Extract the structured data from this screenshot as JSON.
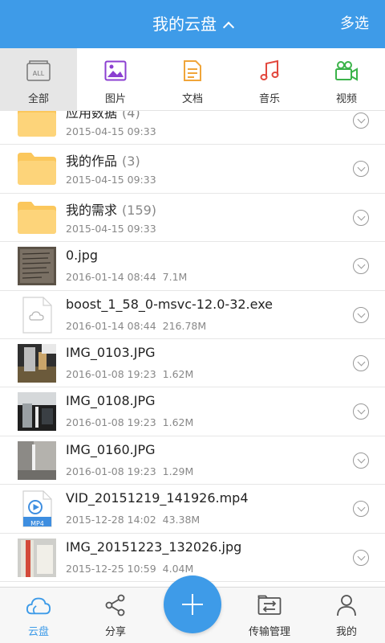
{
  "header": {
    "title": "我的云盘",
    "multi_select": "多选"
  },
  "colors": {
    "accent": "#3e9be8",
    "folder": "#fbc75c"
  },
  "categories": [
    {
      "label": "全部",
      "icon": "all-icon",
      "active": true
    },
    {
      "label": "图片",
      "icon": "image-icon"
    },
    {
      "label": "文档",
      "icon": "document-icon"
    },
    {
      "label": "音乐",
      "icon": "music-icon"
    },
    {
      "label": "视频",
      "icon": "video-icon"
    }
  ],
  "files": [
    {
      "name": "应用数据",
      "count": "(4)",
      "date": "2015-04-15 09:33",
      "size": "",
      "kind": "folder"
    },
    {
      "name": "我的作品",
      "count": "(3)",
      "date": "2015-04-15 09:33",
      "size": "",
      "kind": "folder"
    },
    {
      "name": "我的需求",
      "count": "(159)",
      "date": "2015-04-15 09:33",
      "size": "",
      "kind": "folder"
    },
    {
      "name": "0.jpg",
      "count": "",
      "date": "2016-01-14 08:44",
      "size": "7.1M",
      "kind": "photo"
    },
    {
      "name": "boost_1_58_0-msvc-12.0-32.exe",
      "count": "",
      "date": "2016-01-14 08:44",
      "size": "216.78M",
      "kind": "file"
    },
    {
      "name": "IMG_0103.JPG",
      "count": "",
      "date": "2016-01-08 19:23",
      "size": "1.62M",
      "kind": "photo"
    },
    {
      "name": "IMG_0108.JPG",
      "count": "",
      "date": "2016-01-08 19:23",
      "size": "1.62M",
      "kind": "photo"
    },
    {
      "name": "IMG_0160.JPG",
      "count": "",
      "date": "2016-01-08 19:23",
      "size": "1.29M",
      "kind": "photo"
    },
    {
      "name": "VID_20151219_141926.mp4",
      "count": "",
      "date": "2015-12-28 14:02",
      "size": "43.38M",
      "kind": "video",
      "badge": "MP4"
    },
    {
      "name": "IMG_20151223_132026.jpg",
      "count": "",
      "date": "2015-12-25 10:59",
      "size": "4.04M",
      "kind": "photo"
    }
  ],
  "tabs": [
    {
      "label": "云盘",
      "icon": "cloud-icon",
      "active": true
    },
    {
      "label": "分享",
      "icon": "share-icon"
    },
    {
      "label": "",
      "icon": "add-icon"
    },
    {
      "label": "传输管理",
      "icon": "transfer-icon"
    },
    {
      "label": "我的",
      "icon": "profile-icon"
    }
  ]
}
